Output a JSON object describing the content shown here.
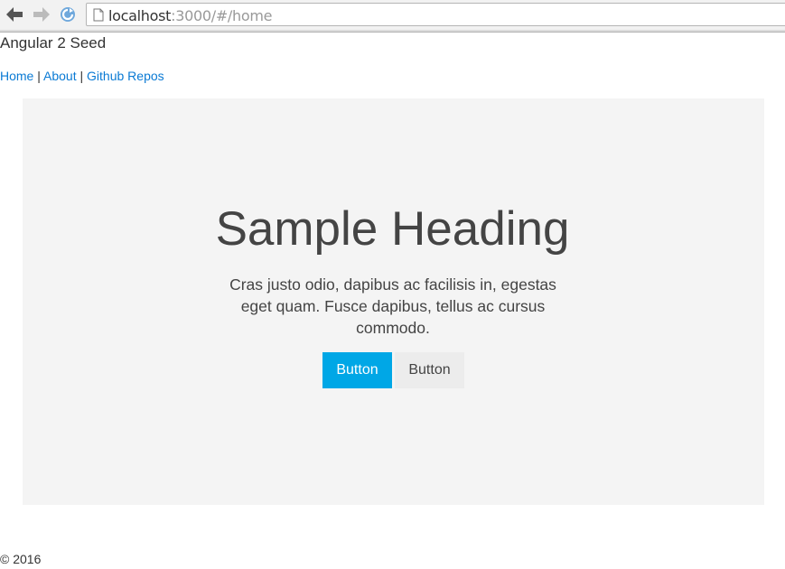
{
  "browser": {
    "url_host": "localhost",
    "url_rest": ":3000/#/home",
    "icons": {
      "back": "back-arrow-icon",
      "forward": "forward-arrow-icon",
      "reload": "reload-icon",
      "page": "page-icon"
    }
  },
  "site": {
    "title": "Angular 2 Seed",
    "nav": [
      {
        "label": "Home"
      },
      {
        "label": "About"
      },
      {
        "label": "Github Repos"
      }
    ],
    "separator": " | "
  },
  "hero": {
    "heading": "Sample Heading",
    "lead": "Cras justo odio, dapibus ac facilisis in, egestas eget quam. Fusce dapibus, tellus ac cursus commodo.",
    "primary_button": "Button",
    "secondary_button": "Button"
  },
  "footer": {
    "text": "© 2016"
  }
}
